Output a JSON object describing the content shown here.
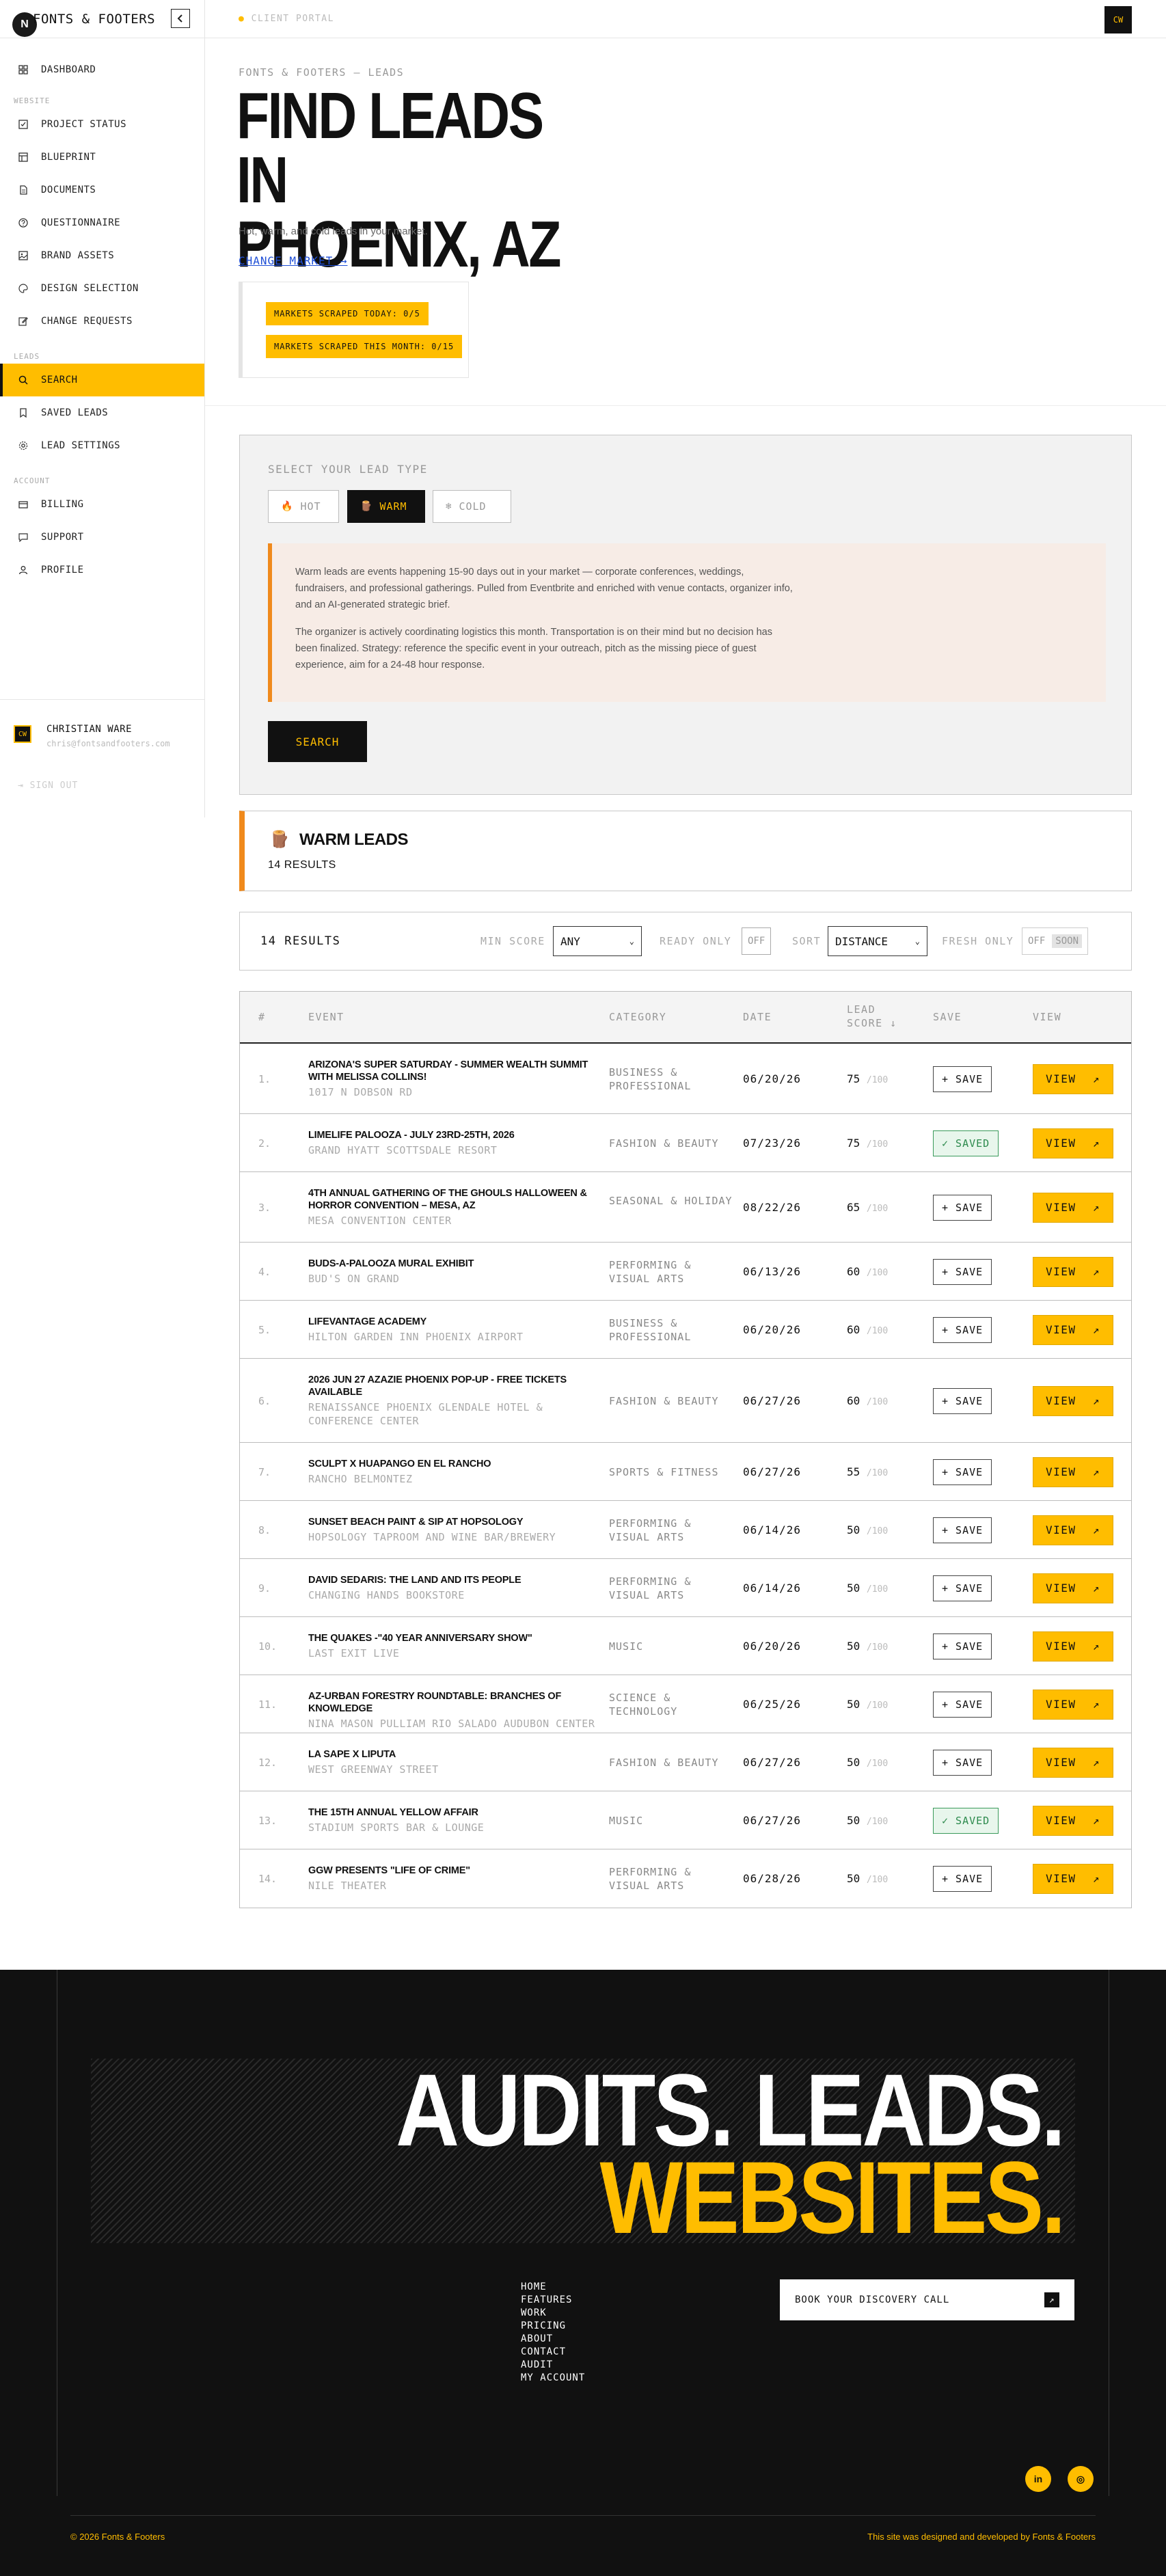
{
  "sidebar": {
    "logo_letter": "N",
    "brand": "FONTS & FOOTERS",
    "collapse_icon": "chevron-left-icon",
    "sections": {
      "website": "WEBSITE",
      "leads": "LEADS",
      "account": "ACCOUNT"
    },
    "items": [
      {
        "label": "DASHBOARD",
        "icon": "grid-icon"
      },
      {
        "label": "PROJECT STATUS",
        "icon": "check-square-icon"
      },
      {
        "label": "BLUEPRINT",
        "icon": "layout-icon"
      },
      {
        "label": "DOCUMENTS",
        "icon": "file-icon"
      },
      {
        "label": "QUESTIONNAIRE",
        "icon": "help-circle-icon"
      },
      {
        "label": "BRAND ASSETS",
        "icon": "image-icon"
      },
      {
        "label": "DESIGN SELECTION",
        "icon": "palette-icon"
      },
      {
        "label": "CHANGE REQUESTS",
        "icon": "edit-icon"
      },
      {
        "label": "SEARCH",
        "icon": "search-icon"
      },
      {
        "label": "SAVED LEADS",
        "icon": "bookmark-icon"
      },
      {
        "label": "LEAD SETTINGS",
        "icon": "gear-icon"
      },
      {
        "label": "BILLING",
        "icon": "credit-card-icon"
      },
      {
        "label": "SUPPORT",
        "icon": "chat-icon"
      },
      {
        "label": "PROFILE",
        "icon": "user-icon"
      }
    ],
    "user": {
      "initials": "CW",
      "name": "CHRISTIAN WARE",
      "email": "chris@fontsandfooters.com"
    },
    "sign_out": "SIGN OUT"
  },
  "topbar": {
    "portal": "CLIENT PORTAL",
    "initials": "CW"
  },
  "hero": {
    "breadcrumb": "FONTS & FOOTERS — LEADS",
    "title_line1": "FIND LEADS IN",
    "title_line2": "PHOENIX, AZ",
    "subtitle": "Hot, warm, and cold leads in your market.",
    "change_market": "CHANGE MARKET →",
    "scraped_today": "MARKETS SCRAPED TODAY: 0/5",
    "scraped_month": "MARKETS SCRAPED THIS MONTH: 0/15"
  },
  "lead_type": {
    "label": "SELECT YOUR LEAD TYPE",
    "options": [
      {
        "label": "HOT",
        "icon": "🔥"
      },
      {
        "label": "WARM",
        "icon": "🪵"
      },
      {
        "label": "COLD",
        "icon": "❄"
      }
    ],
    "selected": "WARM",
    "info_p1": "Warm leads are events happening 15-90 days out in your market — corporate conferences, weddings, fundraisers, and professional gatherings. Pulled from Eventbrite and enriched with venue contacts, organizer info, and an AI-generated strategic brief.",
    "info_p2": "The organizer is actively coordinating logistics this month. Transportation is on their mind but no decision has been finalized. Strategy: reference the specific event in your outreach, pitch as the missing piece of guest experience, aim for a 24-48 hour response.",
    "search_label": "SEARCH"
  },
  "results_header": {
    "icon": "🪵",
    "title": "WARM LEADS",
    "count": "14 RESULTS"
  },
  "filters": {
    "results": "14 RESULTS",
    "min_score_label": "MIN SCORE",
    "min_score_value": "ANY",
    "ready_only_label": "READY ONLY",
    "ready_only_value": "OFF",
    "sort_label": "SORT",
    "sort_value": "DISTANCE",
    "fresh_only_label": "FRESH ONLY",
    "fresh_only_value": "OFF",
    "fresh_only_badge": "SOON"
  },
  "table": {
    "headers": {
      "num": "#",
      "event": "EVENT",
      "category": "CATEGORY",
      "date": "DATE",
      "score": "LEAD SCORE ↓",
      "save": "SAVE",
      "view": "VIEW"
    },
    "score_max": "/100",
    "save_label": "+ SAVE",
    "saved_label": "✓ SAVED",
    "view_label": "VIEW",
    "rows": [
      {
        "num": "1.",
        "title": "ARIZONA'S SUPER SATURDAY - SUMMER WEALTH SUMMIT WITH MELISSA COLLINS!",
        "venue": "1017 N DOBSON RD",
        "category": "BUSINESS & PROFESSIONAL",
        "date": "06/20/26",
        "score": "75",
        "saved": false
      },
      {
        "num": "2.",
        "title": "LIMELIFE PALOOZA - JULY 23RD-25TH, 2026",
        "venue": "GRAND HYATT SCOTTSDALE RESORT",
        "category": "FASHION & BEAUTY",
        "date": "07/23/26",
        "score": "75",
        "saved": true
      },
      {
        "num": "3.",
        "title": "4TH ANNUAL GATHERING OF THE GHOULS HALLOWEEN & HORROR CONVENTION – MESA, AZ",
        "venue": "MESA CONVENTION CENTER",
        "category": "SEASONAL & HOLIDAY",
        "date": "08/22/26",
        "score": "65",
        "saved": false
      },
      {
        "num": "4.",
        "title": "BUDS-A-PALOOZA MURAL EXHIBIT",
        "venue": "BUD'S ON GRAND",
        "category": "PERFORMING & VISUAL ARTS",
        "date": "06/13/26",
        "score": "60",
        "saved": false
      },
      {
        "num": "5.",
        "title": "LIFEVANTAGE ACADEMY",
        "venue": "HILTON GARDEN INN PHOENIX AIRPORT",
        "category": "BUSINESS & PROFESSIONAL",
        "date": "06/20/26",
        "score": "60",
        "saved": false
      },
      {
        "num": "6.",
        "title": "2026 JUN 27 AZAZIE PHOENIX POP-UP - FREE TICKETS AVAILABLE",
        "venue": "RENAISSANCE PHOENIX GLENDALE HOTEL & CONFERENCE CENTER",
        "category": "FASHION & BEAUTY",
        "date": "06/27/26",
        "score": "60",
        "saved": false
      },
      {
        "num": "7.",
        "title": "SCULPT X HUAPANGO EN EL RANCHO",
        "venue": "RANCHO BELMONTEZ",
        "category": "SPORTS & FITNESS",
        "date": "06/27/26",
        "score": "55",
        "saved": false
      },
      {
        "num": "8.",
        "title": "SUNSET BEACH PAINT & SIP AT HOPSOLOGY",
        "venue": "HOPSOLOGY TAPROOM AND WINE BAR/BREWERY",
        "category": "PERFORMING & VISUAL ARTS",
        "date": "06/14/26",
        "score": "50",
        "saved": false
      },
      {
        "num": "9.",
        "title": "DAVID SEDARIS: THE LAND AND ITS PEOPLE",
        "venue": "CHANGING HANDS BOOKSTORE",
        "category": "PERFORMING & VISUAL ARTS",
        "date": "06/14/26",
        "score": "50",
        "saved": false
      },
      {
        "num": "10.",
        "title": "THE QUAKES -\"40 YEAR ANNIVERSARY SHOW\"",
        "venue": "LAST EXIT LIVE",
        "category": "MUSIC",
        "date": "06/20/26",
        "score": "50",
        "saved": false
      },
      {
        "num": "11.",
        "title": "AZ-URBAN FORESTRY ROUNDTABLE: BRANCHES OF KNOWLEDGE",
        "venue": "NINA MASON PULLIAM RIO SALADO AUDUBON CENTER",
        "category": "SCIENCE & TECHNOLOGY",
        "date": "06/25/26",
        "score": "50",
        "saved": false
      },
      {
        "num": "12.",
        "title": "LA SAPE X LIPUTA",
        "venue": "WEST GREENWAY STREET",
        "category": "FASHION & BEAUTY",
        "date": "06/27/26",
        "score": "50",
        "saved": false
      },
      {
        "num": "13.",
        "title": "THE 15TH ANNUAL YELLOW AFFAIR",
        "venue": "STADIUM SPORTS BAR & LOUNGE",
        "category": "MUSIC",
        "date": "06/27/26",
        "score": "50",
        "saved": true
      },
      {
        "num": "14.",
        "title": "GGW PRESENTS \"LIFE OF CRIME\"",
        "venue": "NILE THEATER",
        "category": "PERFORMING & VISUAL ARTS",
        "date": "06/28/26",
        "score": "50",
        "saved": false
      }
    ]
  },
  "footer": {
    "headline_1": "AUDITS. LEADS.",
    "headline_2": "WEBSITES.",
    "nav": [
      "HOME",
      "FEATURES",
      "WORK",
      "PRICING",
      "ABOUT",
      "CONTACT",
      "AUDIT",
      "MY ACCOUNT"
    ],
    "cta": "BOOK YOUR DISCOVERY CALL",
    "social": [
      {
        "label": "in",
        "icon": "linkedin-icon"
      },
      {
        "label": "◎",
        "icon": "instagram-icon"
      }
    ],
    "copyright": "© 2026 Fonts & Footers",
    "credit": "This site was designed and developed by Fonts & Footers"
  },
  "colors": {
    "accent": "#ffbd00",
    "warm": "#f08a1c",
    "dark": "#111111",
    "link": "#1f4fd6",
    "saved": "#2d8a4d"
  }
}
